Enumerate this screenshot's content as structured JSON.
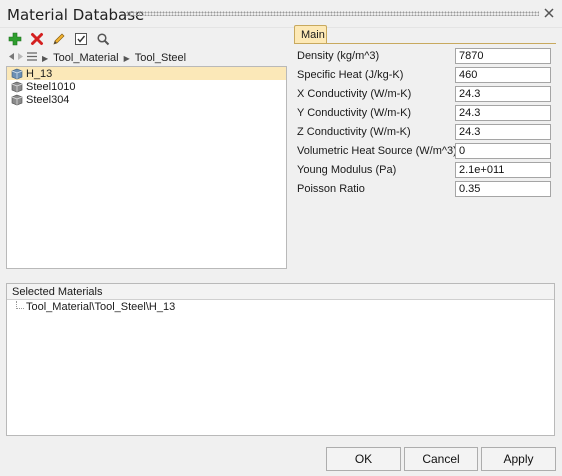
{
  "window": {
    "title": "Material Database"
  },
  "toolbar": {
    "icons": [
      "add-icon",
      "delete-icon",
      "edit-icon",
      "checklist-icon",
      "search-icon"
    ]
  },
  "breadcrumb": {
    "parts": [
      "Tool_Material",
      "Tool_Steel"
    ]
  },
  "tree": {
    "items": [
      {
        "label": "H_13",
        "selected": true
      },
      {
        "label": "Steel1010",
        "selected": false
      },
      {
        "label": "Steel304",
        "selected": false
      }
    ]
  },
  "tabs": {
    "main": "Main"
  },
  "properties": [
    {
      "label": "Density (kg/m^3)",
      "value": "7870"
    },
    {
      "label": "Specific Heat (J/kg-K)",
      "value": "460"
    },
    {
      "label": "X Conductivity (W/m-K)",
      "value": "24.3"
    },
    {
      "label": "Y Conductivity (W/m-K)",
      "value": "24.3"
    },
    {
      "label": "Z Conductivity (W/m-K)",
      "value": "24.3"
    },
    {
      "label": "Volumetric Heat Source (W/m^3)",
      "value": "0"
    },
    {
      "label": "Young Modulus (Pa)",
      "value": "2.1e+011"
    },
    {
      "label": "Poisson Ratio",
      "value": "0.35"
    }
  ],
  "selected_materials": {
    "header": "Selected Materials",
    "items": [
      "Tool_Material\\Tool_Steel\\H_13"
    ]
  },
  "buttons": {
    "ok": "OK",
    "cancel": "Cancel",
    "apply": "Apply"
  },
  "colors": {
    "selection": "#fbe8b8",
    "tab": "#fde9b6",
    "add": "#2e9e2e",
    "delete": "#d42020"
  }
}
